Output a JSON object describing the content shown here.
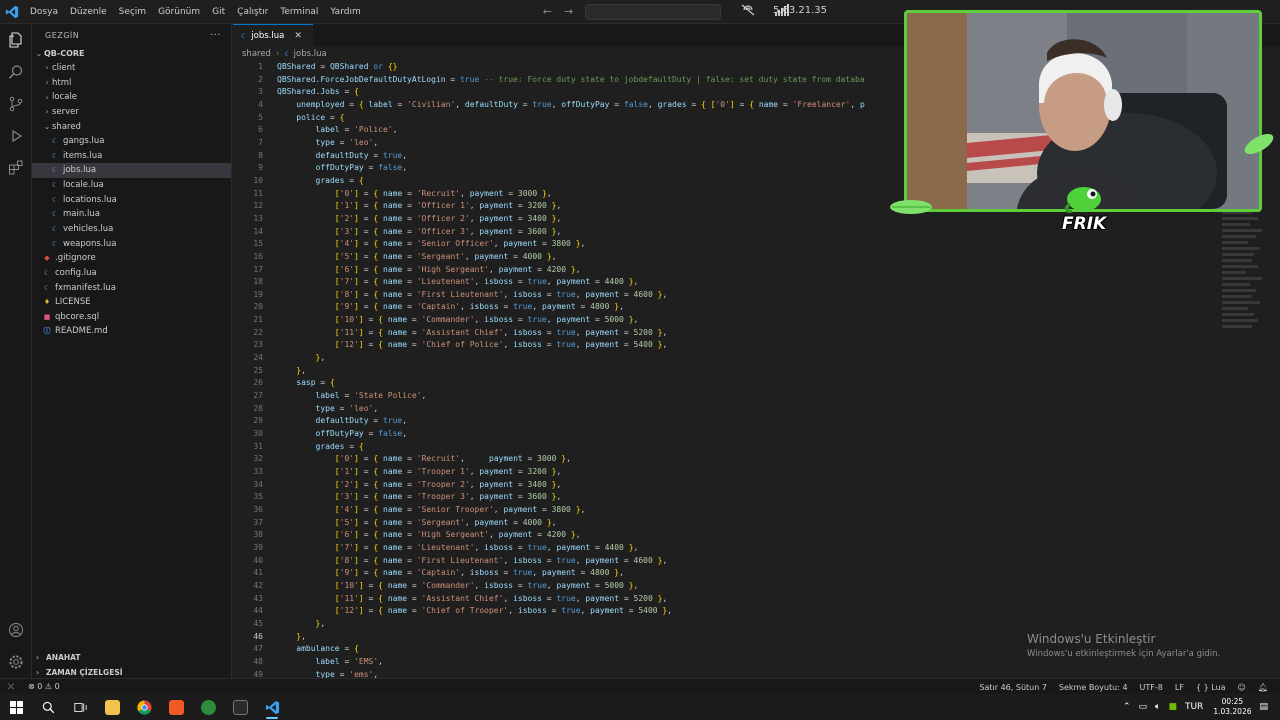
{
  "menu": [
    "Dosya",
    "Düzenle",
    "Seçim",
    "Görünüm",
    "Git",
    "Çalıştır",
    "Terminal",
    "Yardım"
  ],
  "window_title": "5.63.21.35",
  "sidebar": {
    "title": "GEZGİN",
    "root": "QB-CORE",
    "tree": [
      {
        "label": "client",
        "kind": "folder",
        "expanded": false,
        "indent": 1
      },
      {
        "label": "html",
        "kind": "folder",
        "expanded": false,
        "indent": 1
      },
      {
        "label": "locale",
        "kind": "folder",
        "expanded": false,
        "indent": 1
      },
      {
        "label": "server",
        "kind": "folder",
        "expanded": false,
        "indent": 1
      },
      {
        "label": "shared",
        "kind": "folder",
        "expanded": true,
        "indent": 1
      },
      {
        "label": "gangs.lua",
        "kind": "lua",
        "indent": 2
      },
      {
        "label": "items.lua",
        "kind": "lua",
        "indent": 2
      },
      {
        "label": "jobs.lua",
        "kind": "lua",
        "indent": 2,
        "selected": true
      },
      {
        "label": "locale.lua",
        "kind": "lua",
        "indent": 2
      },
      {
        "label": "locations.lua",
        "kind": "lua",
        "indent": 2
      },
      {
        "label": "main.lua",
        "kind": "lua",
        "indent": 2
      },
      {
        "label": "vehicles.lua",
        "kind": "lua",
        "indent": 2
      },
      {
        "label": "weapons.lua",
        "kind": "lua",
        "indent": 2
      },
      {
        "label": ".gitignore",
        "kind": "git",
        "indent": 1
      },
      {
        "label": "config.lua",
        "kind": "lua",
        "indent": 1
      },
      {
        "label": "fxmanifest.lua",
        "kind": "lua",
        "indent": 1
      },
      {
        "label": "LICENSE",
        "kind": "license",
        "indent": 1
      },
      {
        "label": "qbcore.sql",
        "kind": "sql",
        "indent": 1
      },
      {
        "label": "README.md",
        "kind": "md",
        "indent": 1
      }
    ],
    "outline": "ANAHAT",
    "timeline": "ZAMAN ÇİZELGESİ"
  },
  "editor": {
    "tab": "jobs.lua",
    "breadcrumb": [
      "shared",
      "jobs.lua"
    ],
    "active_line": 46,
    "lines": [
      "QBShared = QBShared or {}",
      "QBShared.ForceJobDefaultDutyAtLogin = true -- true: Force duty state to jobdefaultDuty | false: set duty state from databa",
      "QBShared.Jobs = {",
      "    unemployed = { label = 'Civilian', defaultDuty = true, offDutyPay = false, grades = { ['0'] = { name = 'Freelancer', p",
      "    police = {",
      "        label = 'Police',",
      "        type = 'leo',",
      "        defaultDuty = true,",
      "        offDutyPay = false,",
      "        grades = {",
      "            ['0'] = { name = 'Recruit', payment = 3000 },",
      "            ['1'] = { name = 'Officer 1', payment = 3200 },",
      "            ['2'] = { name = 'Officer 2', payment = 3400 },",
      "            ['3'] = { name = 'Officer 3', payment = 3600 },",
      "            ['4'] = { name = 'Senior Officer', payment = 3800 },",
      "            ['5'] = { name = 'Sergeant', payment = 4000 },",
      "            ['6'] = { name = 'High Sergeant', payment = 4200 },",
      "            ['7'] = { name = 'Lieutenant', isboss = true, payment = 4400 },",
      "            ['8'] = { name = 'First Lieutenant', isboss = true, payment = 4600 },",
      "            ['9'] = { name = 'Captain', isboss = true, payment = 4800 },",
      "            ['10'] = { name = 'Commander', isboss = true, payment = 5000 },",
      "            ['11'] = { name = 'Assistant Chief', isboss = true, payment = 5200 },",
      "            ['12'] = { name = 'Chief of Police', isboss = true, payment = 5400 },",
      "        },",
      "    },",
      "    sasp = {",
      "        label = 'State Police',",
      "        type = 'leo',",
      "        defaultDuty = true,",
      "        offDutyPay = false,",
      "        grades = {",
      "            ['0'] = { name = 'Recruit',     payment = 3000 },",
      "            ['1'] = { name = 'Trooper 1', payment = 3200 },",
      "            ['2'] = { name = 'Trooper 2', payment = 3400 },",
      "            ['3'] = { name = 'Trooper 3', payment = 3600 },",
      "            ['4'] = { name = 'Senior Trooper', payment = 3800 },",
      "            ['5'] = { name = 'Sergeant', payment = 4000 },",
      "            ['6'] = { name = 'High Sergeant', payment = 4200 },",
      "            ['7'] = { name = 'Lieutenant', isboss = true, payment = 4400 },",
      "            ['8'] = { name = 'First Lieutenant', isboss = true, payment = 4600 },",
      "            ['9'] = { name = 'Captain', isboss = true, payment = 4800 },",
      "            ['10'] = { name = 'Commander', isboss = true, payment = 5000 },",
      "            ['11'] = { name = 'Assistant Chief', isboss = true, payment = 5200 },",
      "            ['12'] = { name = 'Chief of Trooper', isboss = true, payment = 5400 },",
      "        },",
      "    },",
      "    ambulance = {",
      "        label = 'EMS',",
      "        type = 'ems',"
    ]
  },
  "webcam": {
    "logo_text": "FRIK"
  },
  "activation": {
    "title": "Windows'u Etkinleştir",
    "subtitle": "Windows'u etkinleştirmek için Ayarlar'a gidin."
  },
  "statusbar": {
    "problems": "⊗ 0 ⚠ 0",
    "cursor": "Satır 46, Sütun 7",
    "indent": "Sekme Boyutu: 4",
    "encoding": "UTF-8",
    "eol": "LF",
    "language": "{ } Lua"
  },
  "taskbar": {
    "language": "TUR",
    "time": "00:25",
    "date": "1.03.2026"
  },
  "colors": {
    "accent": "#0078d4",
    "webcam_border": "#5ecf3a"
  }
}
